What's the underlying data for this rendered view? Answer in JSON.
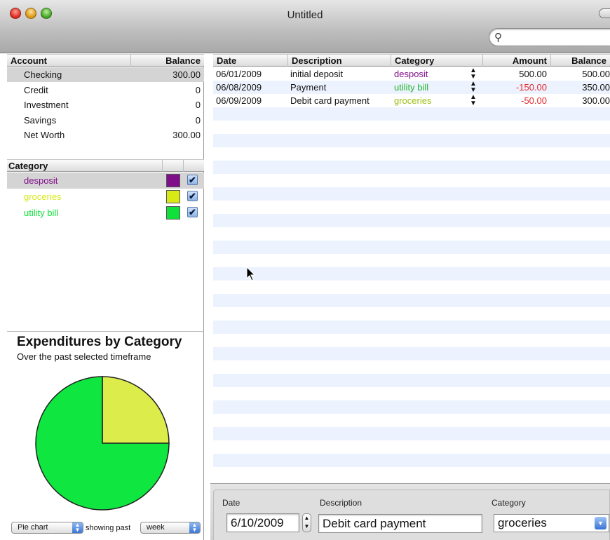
{
  "window": {
    "title": "Untitled"
  },
  "search": {
    "placeholder": "",
    "value": ""
  },
  "accounts": {
    "header": {
      "account": "Account",
      "balance": "Balance"
    },
    "rows": [
      {
        "name": "Checking",
        "balance": "300.00"
      },
      {
        "name": "Credit",
        "balance": "0"
      },
      {
        "name": "Investment",
        "balance": "0"
      },
      {
        "name": "Savings",
        "balance": "0"
      },
      {
        "name": "Net Worth",
        "balance": "300.00"
      }
    ]
  },
  "categories": {
    "header": {
      "category": "Category"
    },
    "rows": [
      {
        "name": "desposit",
        "color": "#800d8a",
        "checked": true
      },
      {
        "name": "groceries",
        "color": "#d8ea16",
        "checked": true
      },
      {
        "name": "utility bill",
        "color": "#10e03a",
        "checked": true
      }
    ]
  },
  "chart": {
    "title": "Expenditures by Category",
    "subtitle": "Over the past selected timeframe",
    "chart_type_label": "Pie chart",
    "showing_label": "showing past",
    "period_label": "week"
  },
  "chart_data": {
    "type": "pie",
    "title": "Expenditures by Category",
    "subtitle": "Over the past selected timeframe",
    "slices": [
      {
        "label": "groceries",
        "value": 50,
        "color": "#dcec4a"
      },
      {
        "label": "utility bill",
        "value": 150,
        "color": "#0fe640"
      }
    ]
  },
  "ledger": {
    "headers": {
      "date": "Date",
      "description": "Description",
      "category": "Category",
      "amount": "Amount",
      "balance": "Balance"
    },
    "rows": [
      {
        "date": "06/01/2009",
        "description": "initial deposit",
        "category": "desposit",
        "category_color": "#800d8a",
        "amount": "500.00",
        "negative": false,
        "balance": "500.00"
      },
      {
        "date": "06/08/2009",
        "description": "Payment",
        "category": "utility bill",
        "category_color": "#1fb52d",
        "amount": "-150.00",
        "negative": true,
        "balance": "350.00"
      },
      {
        "date": "06/09/2009",
        "description": "Debit card payment",
        "category": "groceries",
        "category_color": "#9fbf12",
        "amount": "-50.00",
        "negative": true,
        "balance": "300.00"
      }
    ]
  },
  "entry": {
    "date_label": "Date",
    "date_value": "6/10/2009",
    "description_label": "Description",
    "description_value": "Debit card payment",
    "category_label": "Category",
    "category_value": "groceries"
  }
}
